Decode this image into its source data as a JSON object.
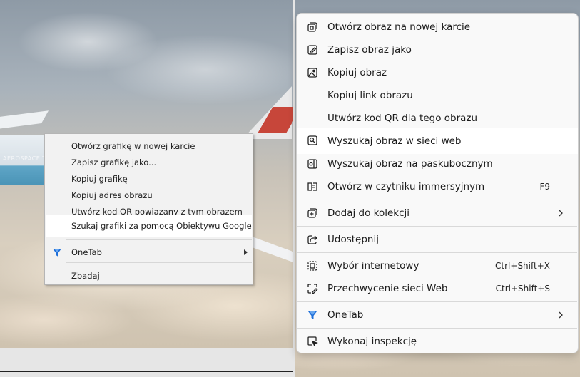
{
  "left_menu": {
    "items": [
      {
        "label": "Otwórz grafikę w nowej karcie"
      },
      {
        "label": "Zapisz grafikę jako..."
      },
      {
        "label": "Kopiuj grafikę"
      },
      {
        "label": "Kopiuj adres obrazu"
      },
      {
        "label": "Utwórz kod QR powiązany z tym obrazem"
      },
      {
        "label": "Szukaj grafiki za pomocą Obiektywu Google"
      },
      {
        "label": "OneTab",
        "icon": "onetab-funnel-icon",
        "has_submenu": true
      },
      {
        "label": "Zbadaj"
      }
    ],
    "highlighted_index": 5
  },
  "right_menu": {
    "items": [
      {
        "label": "Otwórz obraz na nowej karcie",
        "icon": "new-tab-icon"
      },
      {
        "label": "Zapisz obraz jako",
        "icon": "save-image-icon"
      },
      {
        "label": "Kopiuj obraz",
        "icon": "copy-image-icon"
      },
      {
        "label": "Kopiuj link obrazu"
      },
      {
        "label": "Utwórz kod QR dla tego obrazu"
      },
      {
        "label": "Wyszukaj obraz w sieci web",
        "icon": "visual-search-icon"
      },
      {
        "label": "Wyszukaj obraz na paskubocznym",
        "icon": "sidebar-search-icon"
      },
      {
        "label": "Otwórz w czytniku immersyjnym",
        "icon": "immersive-reader-icon",
        "shortcut": "F9"
      },
      {
        "label": "Dodaj do kolekcji",
        "icon": "collections-icon",
        "has_submenu": true
      },
      {
        "label": "Udostępnij",
        "icon": "share-icon"
      },
      {
        "label": "Wybór internetowy",
        "icon": "web-select-icon",
        "shortcut": "Ctrl+Shift+X"
      },
      {
        "label": "Przechwycenie sieci Web",
        "icon": "web-capture-icon",
        "shortcut": "Ctrl+Shift+S"
      },
      {
        "label": "OneTab",
        "icon": "onetab-funnel-icon",
        "has_submenu": true
      },
      {
        "label": "Wykonaj inspekcję",
        "icon": "inspect-icon"
      }
    ],
    "highlighted_index": 5
  },
  "background": {
    "plane_text": "AEROSPACE TEC",
    "onetab_color": "#1e6fd9",
    "tail_color": "#c7463a"
  }
}
